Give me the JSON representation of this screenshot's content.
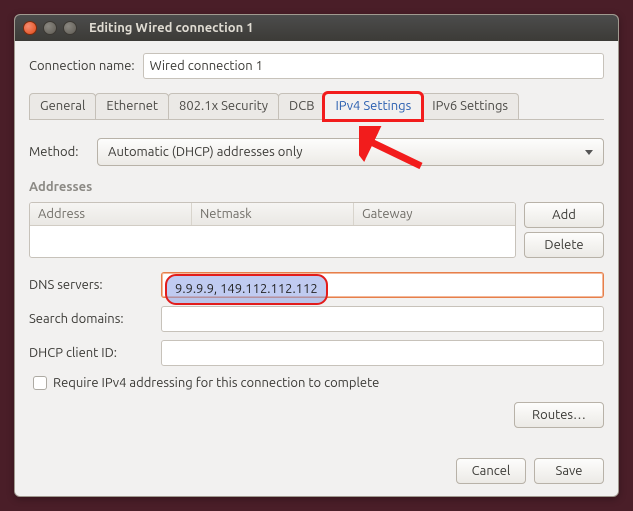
{
  "window": {
    "title": "Editing Wired connection 1"
  },
  "connection_name": {
    "label": "Connection name:",
    "value": "Wired connection 1"
  },
  "tabs": {
    "general": "General",
    "ethernet": "Ethernet",
    "security": "802.1x Security",
    "dcb": "DCB",
    "ipv4": "IPv4 Settings",
    "ipv6": "IPv6 Settings"
  },
  "method": {
    "label": "Method:",
    "value": "Automatic (DHCP) addresses only"
  },
  "addresses": {
    "section": "Addresses",
    "cols": {
      "address": "Address",
      "netmask": "Netmask",
      "gateway": "Gateway"
    },
    "add": "Add",
    "delete": "Delete"
  },
  "dns": {
    "label": "DNS servers:",
    "value": "9.9.9.9, 149.112.112.112"
  },
  "search_domains": {
    "label": "Search domains:",
    "value": ""
  },
  "dhcp_client": {
    "label": "DHCP client ID:",
    "value": ""
  },
  "require_ipv4": {
    "label": "Require IPv4 addressing for this connection to complete"
  },
  "routes": {
    "label": "Routes…"
  },
  "footer": {
    "cancel": "Cancel",
    "save": "Save"
  }
}
